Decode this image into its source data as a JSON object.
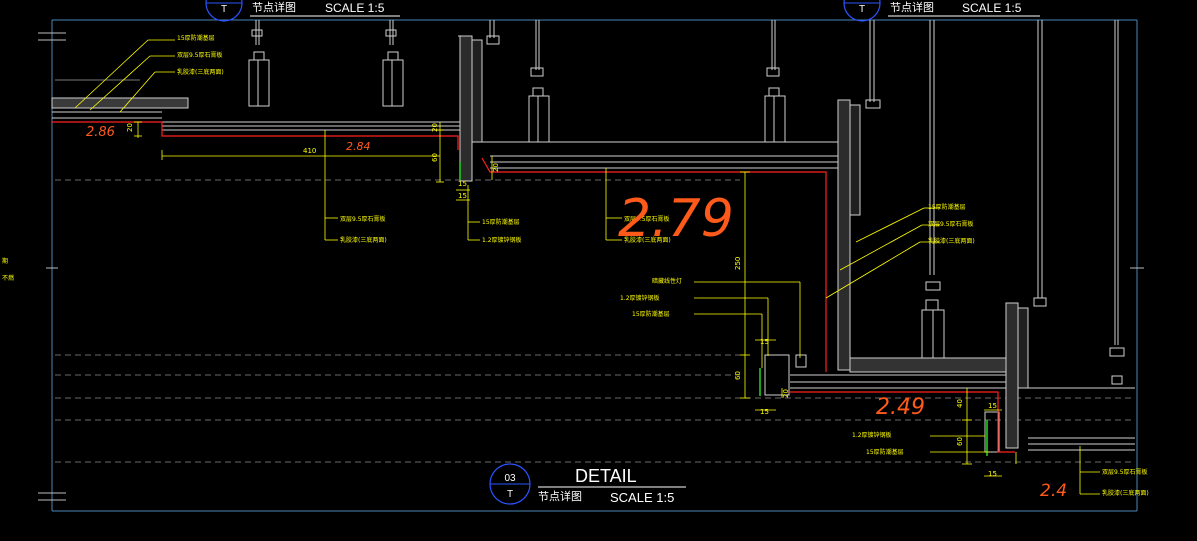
{
  "top_titles": [
    {
      "symbol": "T",
      "label": "节点详图",
      "scale": "SCALE 1:5"
    },
    {
      "symbol": "T",
      "label": "节点详图",
      "scale": "SCALE 1:5"
    }
  ],
  "detail_title": {
    "number": "03",
    "symbol": "T",
    "heading": "DETAIL",
    "label": "节点详图",
    "scale": "SCALE 1:5"
  },
  "handwritten_heights": [
    "2.86",
    "2.84",
    "2.79",
    "2.49",
    "2.4"
  ],
  "dimensions": [
    "20",
    "410",
    "20",
    "60",
    "20",
    "15",
    "15",
    "250",
    "15",
    "60",
    "20",
    "15",
    "40",
    "15",
    "60",
    "15"
  ],
  "left_edge_labels": [
    "期",
    "不燃"
  ],
  "annotations": {
    "group_1": [
      "15厚防潮基层",
      "双层9.5厚石膏板",
      "乳胶漆(三底两面)"
    ],
    "group_2": [
      "双层9.5厚石膏板",
      "乳胶漆(三底两面)"
    ],
    "group_3": [
      "15厚防潮基层",
      "1.2厚镀锌钢板"
    ],
    "group_4": [
      "双层9.5厚石膏板",
      "乳胶漆(三底两面)"
    ],
    "group_5": [
      "15厚防潮基层",
      "双层9.5厚石膏板",
      "乳胶漆(三底两面)"
    ],
    "group_6": [
      "暗藏线性灯",
      "1.2厚镀锌钢板",
      "15厚防潮基层"
    ],
    "group_7": [
      "1.2厚镀锌钢板",
      "15厚防潮基层"
    ],
    "group_8": [
      "双层9.5厚石膏板",
      "乳胶漆(三底两面)"
    ]
  },
  "colors": {
    "background": "#000000",
    "annotation": "#ffff00",
    "structure": "#ffffff",
    "finish_line": "#ff2020",
    "handwriting": "#ff5a1a",
    "title_circle": "#2b55ff",
    "light_strip": "#22cc22"
  }
}
